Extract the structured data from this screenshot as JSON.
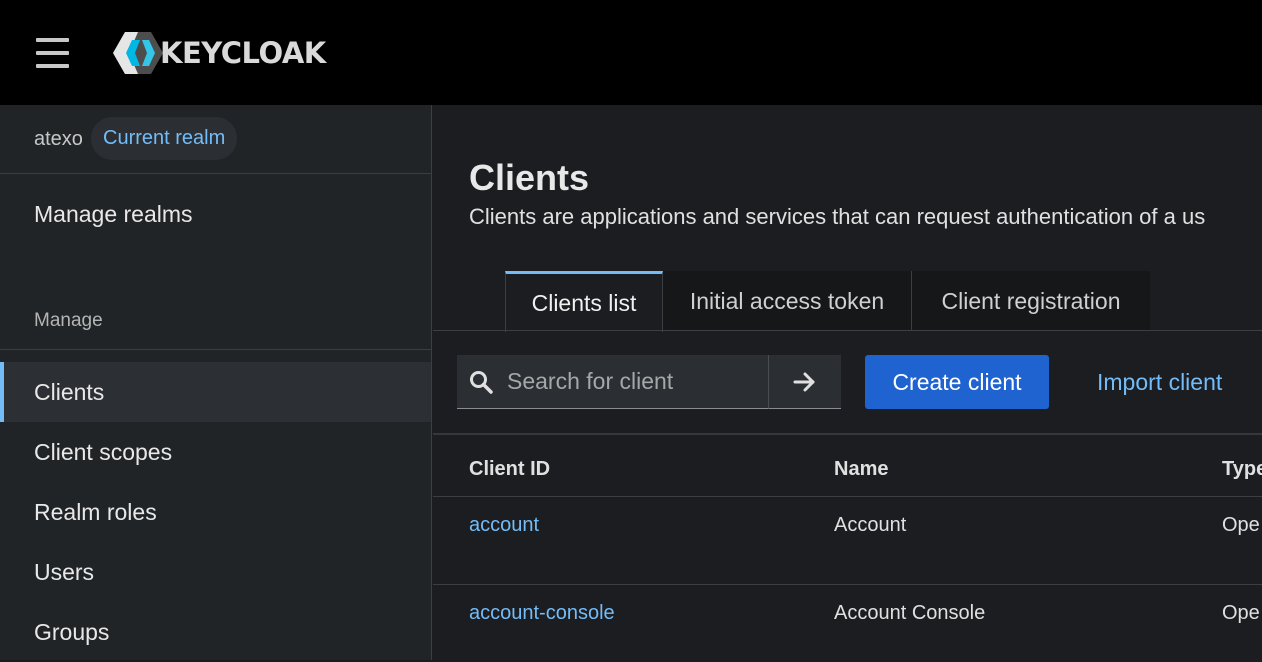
{
  "header": {
    "brand": "KEYCLOAK",
    "menu_icon": "hamburger-menu-icon",
    "logo_icon": "keycloak-logo-icon"
  },
  "sidebar": {
    "realm": {
      "name": "atexo",
      "badge": "Current realm"
    },
    "manage_realms": "Manage realms",
    "section_heading": "Manage",
    "items": [
      {
        "label": "Clients",
        "active": true
      },
      {
        "label": "Client scopes",
        "active": false
      },
      {
        "label": "Realm roles",
        "active": false
      },
      {
        "label": "Users",
        "active": false
      },
      {
        "label": "Groups",
        "active": false
      }
    ]
  },
  "main": {
    "title": "Clients",
    "description": "Clients are applications and services that can request authentication of a us",
    "tabs": [
      {
        "label": "Clients list",
        "active": true
      },
      {
        "label": "Initial access token",
        "active": false
      },
      {
        "label": "Client registration",
        "active": false
      }
    ],
    "toolbar": {
      "search_placeholder": "Search for client",
      "search_value": "",
      "search_icon": "search-icon",
      "go_icon": "arrow-right-icon",
      "create_label": "Create client",
      "import_label": "Import client"
    },
    "table": {
      "columns": [
        "Client ID",
        "Name",
        "Type"
      ],
      "rows": [
        {
          "client_id": "account",
          "name": "Account",
          "type": "Ope"
        },
        {
          "client_id": "account-console",
          "name": "Account Console",
          "type": "Ope"
        }
      ]
    }
  },
  "colors": {
    "accent": "#73bcf7",
    "primary_button": "#1f63d0",
    "masthead": "#000000",
    "sidebar": "#212427",
    "background": "#1b1d21"
  }
}
